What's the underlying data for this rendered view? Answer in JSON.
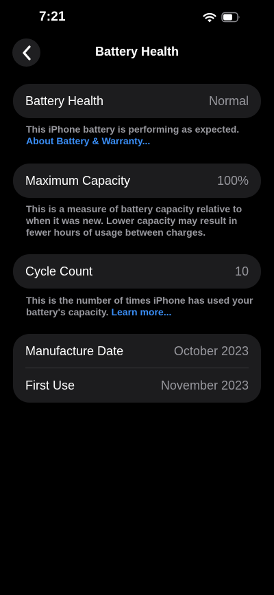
{
  "status_bar": {
    "time": "7:21"
  },
  "nav": {
    "title": "Battery Health"
  },
  "battery_health": {
    "label": "Battery Health",
    "value": "Normal",
    "note": "This iPhone battery is performing as expected.",
    "link": "About Battery & Warranty..."
  },
  "maximum_capacity": {
    "label": "Maximum Capacity",
    "value": "100%",
    "note": "This is a measure of battery capacity relative to when it was new. Lower capacity may result in fewer hours of usage between charges."
  },
  "cycle_count": {
    "label": "Cycle Count",
    "value": "10",
    "note": "This is the number of times iPhone has used your battery's capacity.",
    "link": "Learn more..."
  },
  "dates": {
    "manufacture_label": "Manufacture Date",
    "manufacture_value": "October 2023",
    "first_use_label": "First Use",
    "first_use_value": "November 2023"
  },
  "colors": {
    "background": "#000000",
    "card": "#1c1c1e",
    "secondary_text": "#98989e",
    "link": "#3a8ef6"
  },
  "icons": [
    "wifi-icon",
    "battery-icon",
    "chevron-left-icon"
  ]
}
